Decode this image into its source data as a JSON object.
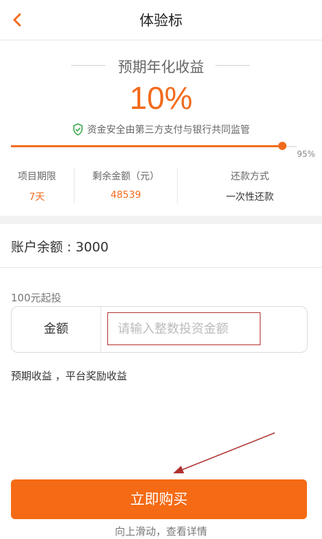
{
  "header": {
    "title": "体验标",
    "back_icon": "chevron-left-icon"
  },
  "yield": {
    "label": "预期年化收益",
    "rate": "10%",
    "safety_text": "资金安全由第三方支付与银行共同监管",
    "progress_percent": 95,
    "progress_label": "95%"
  },
  "stats": [
    {
      "label": "项目期限",
      "value": "7天"
    },
    {
      "label": "剩余金额（元）",
      "value": "48539"
    },
    {
      "label": "还款方式",
      "value": "一次性还款"
    }
  ],
  "account": {
    "balance_text": "账户余额 : 3000"
  },
  "invest": {
    "min_text": "100元起投",
    "amount_label": "金额",
    "placeholder": "请输入整数投资金额",
    "value": ""
  },
  "expected_text": "预期收益 ，平台奖励收益",
  "buy_button": "立即购买",
  "scroll_hint": "向上滑动，查看详情",
  "colors": {
    "accent": "#f26b1d",
    "button": "#f56a14",
    "annotation": "#b03030"
  }
}
